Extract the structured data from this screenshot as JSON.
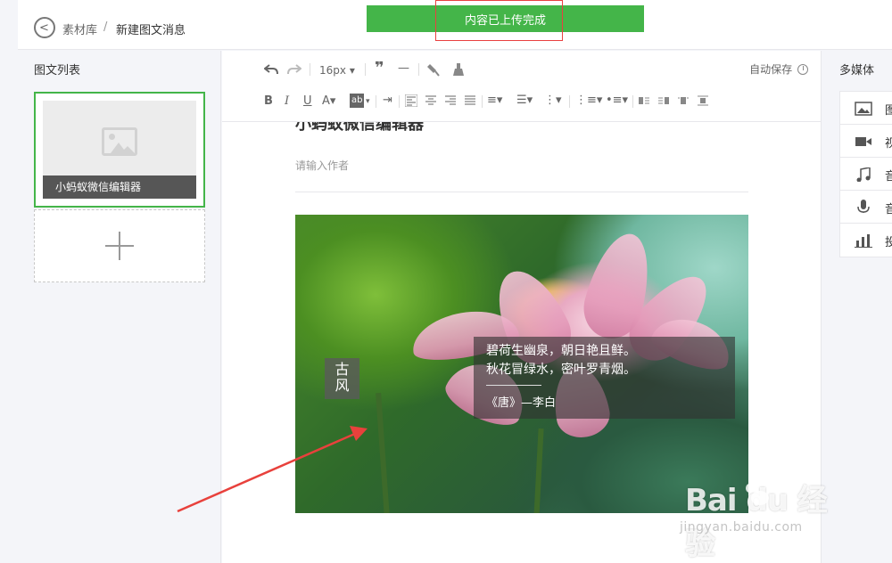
{
  "breadcrumb": {
    "home": "素材库",
    "separator": "/",
    "current": "新建图文消息"
  },
  "toast": {
    "message": "内容已上传完成"
  },
  "left_panel": {
    "title": "图文列表",
    "article_title": "小蚂蚁微信编辑器"
  },
  "toolbar": {
    "undo_icon": "undo-icon",
    "redo_icon": "redo-icon",
    "font_size": "16px",
    "autosave_label": "自动保存",
    "text_buttons": {
      "bold": "B",
      "italic": "I",
      "underline": "U",
      "font_color": "A",
      "bg_color": "ab"
    }
  },
  "editor": {
    "title": "小蚂蚁微信编辑器",
    "author_placeholder": "请输入作者",
    "poem": {
      "line1": "碧荷生幽泉，朝日艳且鲜。",
      "line2": "秋花冒绿水，密叶罗青烟。",
      "source": "《唐》—李白"
    },
    "tag": {
      "char1": "古",
      "char2": "风"
    }
  },
  "right_panel": {
    "title": "多媒体",
    "items": [
      {
        "icon": "image-icon",
        "label": "图片"
      },
      {
        "icon": "video-icon",
        "label": "视频"
      },
      {
        "icon": "music-icon",
        "label": "音乐"
      },
      {
        "icon": "microphone-icon",
        "label": "音频"
      },
      {
        "icon": "poll-chart-icon",
        "label": "投票"
      }
    ]
  },
  "watermark": {
    "brand": "Bai  du 经验",
    "url": "jingyan.baidu.com"
  },
  "colors": {
    "accent": "#44b549",
    "highlight_box": "#e94040",
    "annotation_arrow": "#e8413c"
  }
}
